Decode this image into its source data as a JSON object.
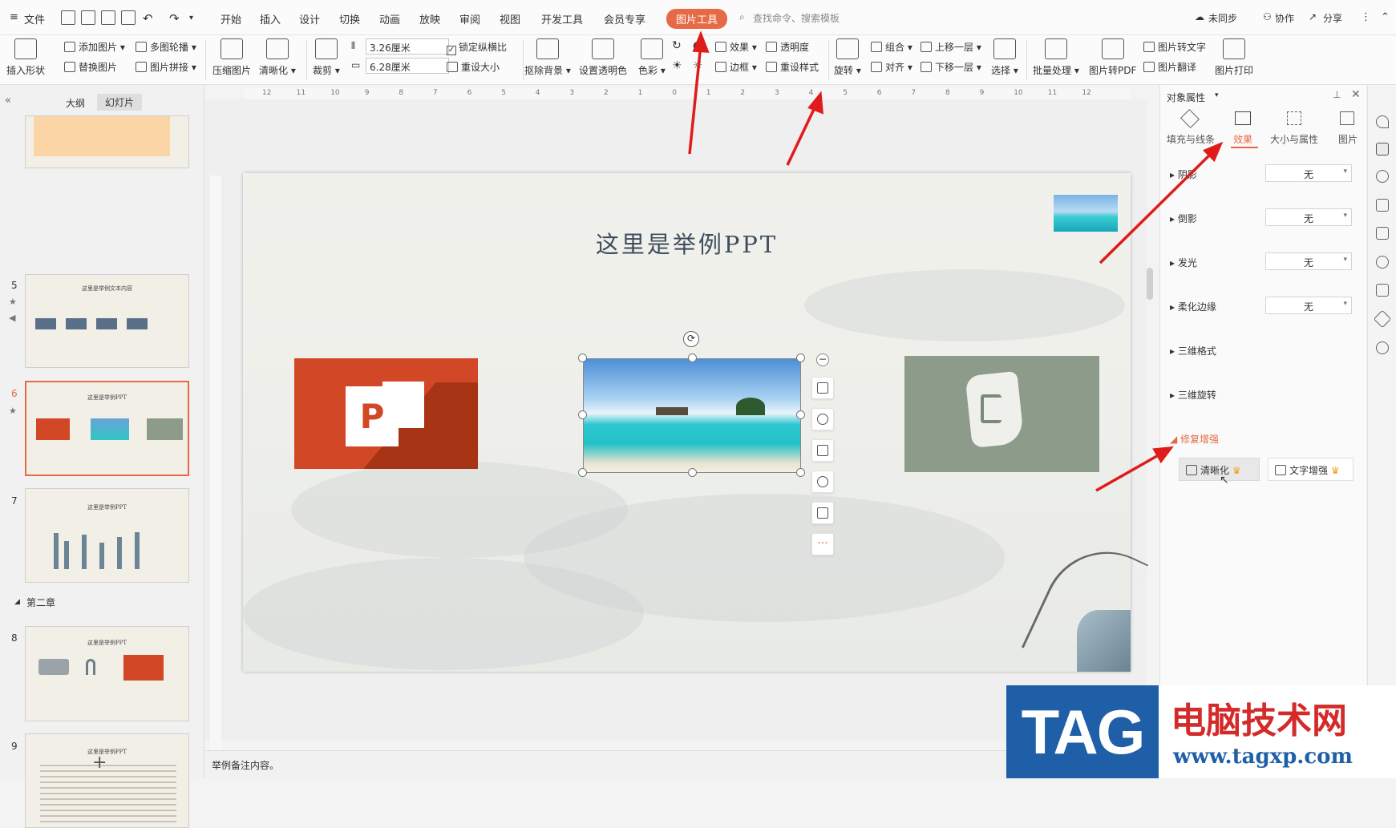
{
  "menu": {
    "file": "文件",
    "tabs": [
      "开始",
      "插入",
      "设计",
      "切换",
      "动画",
      "放映",
      "审阅",
      "视图",
      "开发工具",
      "会员专享"
    ],
    "active_tab": "图片工具",
    "search": "查找命令、搜索模板",
    "sync": "未同步",
    "collab": "协作",
    "share": "分享"
  },
  "ribbon": {
    "insert_shape": "插入形状",
    "add_image": "添加图片",
    "multi_outline": "多图轮播",
    "replace_image": "替换图片",
    "image_collage": "图片拼接",
    "compress": "压缩图片",
    "sharpen": "清晰化",
    "crop": "裁剪",
    "height": "3.26厘米",
    "width": "6.28厘米",
    "lock_ratio": "锁定纵横比",
    "reset_size": "重设大小",
    "remove_bg": "抠除背景",
    "set_transparent": "设置透明色",
    "color": "色彩",
    "effects": "效果",
    "transparency": "透明度",
    "border": "边框",
    "reset_style": "重设样式",
    "rotate": "旋转",
    "group": "组合",
    "align": "对齐",
    "bring_forward": "上移一层",
    "send_backward": "下移一层",
    "select": "选择",
    "batch": "批量处理",
    "to_pdf": "图片转PDF",
    "to_text": "图片转文字",
    "translate": "图片翻译",
    "print": "图片打印"
  },
  "ruler_labels": [
    "12",
    "11",
    "10",
    "9",
    "8",
    "7",
    "6",
    "5",
    "4",
    "3",
    "2",
    "1",
    "0",
    "1",
    "2",
    "3",
    "4",
    "5",
    "6",
    "7",
    "8",
    "9",
    "10",
    "11",
    "12"
  ],
  "left_panel": {
    "tab_outline": "大纲",
    "tab_slides": "幻灯片",
    "slides": [
      {
        "num": "5",
        "title": "这里是举例文本内容"
      },
      {
        "num": "6",
        "title": "这里是举例PPT"
      },
      {
        "num": "7",
        "title": "这里是举例PPT"
      },
      {
        "num": "8",
        "title": "这里是举例PPT"
      },
      {
        "num": "9",
        "title": "这里是举例PPT"
      }
    ],
    "section": "第二章",
    "add": "+"
  },
  "slide": {
    "title": "这里是举例PPT"
  },
  "right_panel": {
    "header": "对象属性",
    "tabs": [
      "填充与线条",
      "效果",
      "大小与属性",
      "图片"
    ],
    "active_tab": "效果",
    "rows": [
      {
        "label": "阴影",
        "value": "无"
      },
      {
        "label": "倒影",
        "value": "无"
      },
      {
        "label": "发光",
        "value": "无"
      },
      {
        "label": "柔化边缘",
        "value": "无"
      },
      {
        "label": "三维格式"
      },
      {
        "label": "三维旋转"
      }
    ],
    "repair": "修复增强",
    "sharpen_btn": "清晰化",
    "text_enhance_btn": "文字增强"
  },
  "status": {
    "notes": "举例备注内容。"
  },
  "watermark": {
    "tag": "TAG",
    "site_cn": "电脑技术网",
    "url": "www.tagxp.com"
  },
  "colors": {
    "accent": "#e56a45",
    "ppt_orange": "#d24726",
    "arrow": "#e01b1b"
  }
}
